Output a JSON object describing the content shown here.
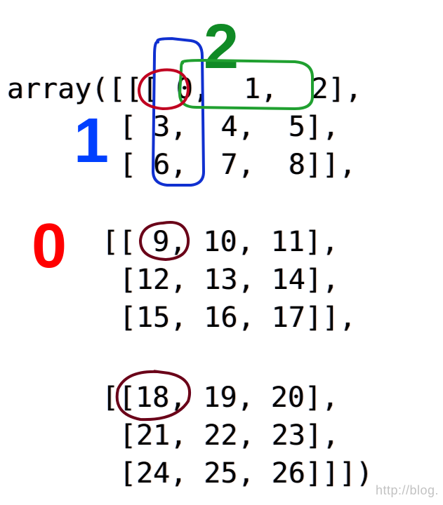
{
  "code_lines": [
    "array([[[ 0,  1,  2],",
    "[ 3,  4,  5],",
    "[ 6,  7,  8]],",
    "[[ 9, 10, 11],",
    "[12, 13, 14],",
    "[15, 16, 17]],",
    "[[18, 19, 20],",
    "[21, 22, 23],",
    "[24, 25, 26]]])"
  ],
  "axis_labels": {
    "axis0": "0",
    "axis1": "1",
    "axis2": "2"
  },
  "axis_colors": {
    "axis0": "#ff0000",
    "axis1": "#0040ff",
    "axis2": "#108a25"
  },
  "array_data": {
    "shape": [
      3,
      3,
      3
    ],
    "values": [
      [
        [
          0,
          1,
          2
        ],
        [
          3,
          4,
          5
        ],
        [
          6,
          7,
          8
        ]
      ],
      [
        [
          9,
          10,
          11
        ],
        [
          12,
          13,
          14
        ],
        [
          15,
          16,
          17
        ]
      ],
      [
        [
          18,
          19,
          20
        ],
        [
          21,
          22,
          23
        ],
        [
          24,
          25,
          26
        ]
      ]
    ]
  },
  "annotations": {
    "axis0_circles_elements": [
      0,
      9,
      18
    ],
    "axis1_column_elements": [
      0,
      3,
      6
    ],
    "axis2_row_elements": [
      0,
      1,
      2
    ]
  },
  "watermark": "http://blog."
}
